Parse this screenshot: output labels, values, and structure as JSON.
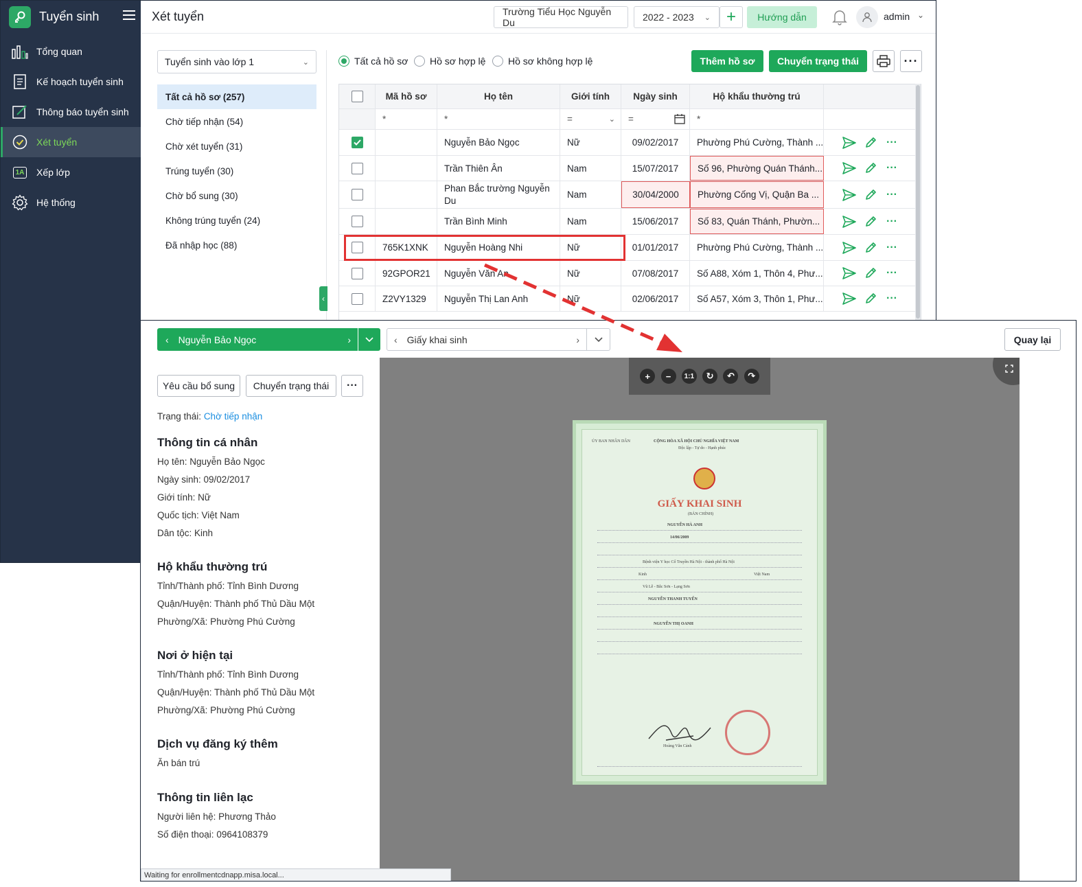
{
  "app": {
    "name": "Tuyển sinh",
    "page_title": "Xét tuyển",
    "school": "Trường Tiểu Học Nguyễn Du",
    "year": "2022 - 2023",
    "guide_label": "Hướng dẫn",
    "user": "admin"
  },
  "sidebar": {
    "items": [
      {
        "label": "Tổng quan",
        "icon": "chart-bars-icon"
      },
      {
        "label": "Kế hoạch tuyển sinh",
        "icon": "document-icon"
      },
      {
        "label": "Thông báo tuyển sinh",
        "icon": "edit-icon"
      },
      {
        "label": "Xét tuyển",
        "icon": "check-circle-icon",
        "active": true
      },
      {
        "label": "Xếp lớp",
        "icon": "class-1a-icon"
      },
      {
        "label": "Hệ thống",
        "icon": "gear-icon"
      }
    ],
    "class_icon_text": "1A"
  },
  "filter": {
    "enroll_select": "Tuyển sinh vào lớp 1",
    "categories": [
      "Tất cả hồ sơ (257)",
      "Chờ tiếp nhận (54)",
      "Chờ xét tuyển (31)",
      "Trúng tuyển (30)",
      "Chờ bổ sung (30)",
      "Không trúng tuyển (24)",
      "Đã nhập học (88)"
    ]
  },
  "toolbar": {
    "radios": [
      "Tất cả hồ sơ",
      "Hồ sơ hợp lệ",
      "Hồ sơ không hợp lệ"
    ],
    "add_label": "Thêm hồ sơ",
    "status_label": "Chuyển trạng thái"
  },
  "grid": {
    "columns": [
      "Mã hồ sơ",
      "Họ tên",
      "Giới tính",
      "Ngày sinh",
      "Hộ khẩu thường trú"
    ],
    "filter_ops": [
      "*",
      "*",
      "=",
      "=",
      "*"
    ],
    "rows": [
      {
        "code": "",
        "name": "Nguyễn Bảo Ngọc",
        "gender": "Nữ",
        "dob": "09/02/2017",
        "address": "Phường Phú Cường, Thành ...",
        "checked": true
      },
      {
        "code": "",
        "name": "Trần Thiên Ân",
        "gender": "Nam",
        "dob": "15/07/2017",
        "address": "Số 96, Phường Quán Thánh..."
      },
      {
        "code": "",
        "name": "Phan Bắc trường Nguyễn",
        "name2": "Du",
        "gender": "Nam",
        "dob": "30/04/2000",
        "address": "Phường Cống Vị, Quận Ba ..."
      },
      {
        "code": "",
        "name": "Trần Bình Minh",
        "gender": "Nam",
        "dob": "15/06/2017",
        "address": "Số 83, Quán Thánh, Phườn..."
      },
      {
        "code": "765K1XNK",
        "name": "Nguyễn Hoàng Nhi",
        "gender": "Nữ",
        "dob": "01/01/2017",
        "address": "Phường Phú Cường, Thành ..."
      },
      {
        "code": "92GPOR21",
        "name": "Nguyễn Văn An",
        "gender": "Nữ",
        "dob": "07/08/2017",
        "address": "Số A88, Xóm 1, Thôn 4, Phư..."
      },
      {
        "code": "Z2VY1329",
        "name": "Nguyễn Thị Lan Anh",
        "gender": "Nữ",
        "dob": "02/06/2017",
        "address": "Số A57, Xóm 3, Thôn 1, Phư..."
      }
    ]
  },
  "popup": {
    "student": "Nguyễn Bảo Ngọc",
    "document": "Giấy khai sinh",
    "back_label": "Quay lại",
    "request_label": "Yêu cầu bổ sung",
    "status_label": "Chuyển trạng thái",
    "status_prefix": "Trạng thái:",
    "status_value": "Chờ tiếp nhận",
    "sections": [
      {
        "title": "Thông tin cá nhân",
        "lines": [
          "Họ tên: Nguyễn Bảo Ngọc",
          "Ngày sinh: 09/02/2017",
          "Giới tính: Nữ",
          "Quốc tịch: Việt Nam",
          "Dân tộc: Kinh"
        ]
      },
      {
        "title": "Hộ khẩu thường trú",
        "lines": [
          "Tỉnh/Thành phố: Tỉnh Bình Dương",
          "Quận/Huyện: Thành phố Thủ Dầu Một",
          "Phường/Xã: Phường Phú Cường"
        ]
      },
      {
        "title": "Nơi ở hiện tại",
        "lines": [
          "Tỉnh/Thành phố: Tỉnh Bình Dương",
          "Quận/Huyện: Thành phố Thủ Dầu Một",
          "Phường/Xã: Phường Phú Cường"
        ]
      },
      {
        "title": "Dịch vụ đăng ký thêm",
        "lines": [
          "Ăn bán trú"
        ]
      },
      {
        "title": "Thông tin liên lạc",
        "lines": [
          "Người liên hệ: Phương Thảo",
          "Số điện thoại: 0964108379"
        ]
      }
    ],
    "viewer_tools": [
      "+",
      "−",
      "1:1",
      "↻",
      "↶",
      "↷"
    ],
    "doc": {
      "title": "GIẤY KHAI SINH",
      "subtitle": "(BẢN CHÍNH)",
      "header_left": "ỦY BAN NHÂN DÂN",
      "header_center": "CỘNG HÒA XÃ HỘI CHỦ NGHĨA VIỆT NAM",
      "motto": "Độc lập - Tự do - Hạnh phúc",
      "child_name": "NGUYỄN HÀ ANH",
      "father": "NGUYỄN THANH TUYẾN",
      "mother": "NGUYỄN THỊ OANH",
      "signer": "Hoàng Văn Cảnh",
      "dob": "14/06/2009",
      "place": "Bệnh viện Y học Cổ Truyền Hà Nội - thành phố Hà Nội",
      "ethnic": "Kinh",
      "nation": "Việt Nam",
      "hometown": "Vũ Lễ - Bắc Sơn - Lạng Sơn"
    },
    "loading_text": "Waiting for enrollmentcdnapp.misa.local..."
  },
  "colors": {
    "sidebar_bg": "#263348",
    "accent_green": "#1ea85a",
    "error_red": "#e23232",
    "link_blue": "#1a8ee0"
  }
}
